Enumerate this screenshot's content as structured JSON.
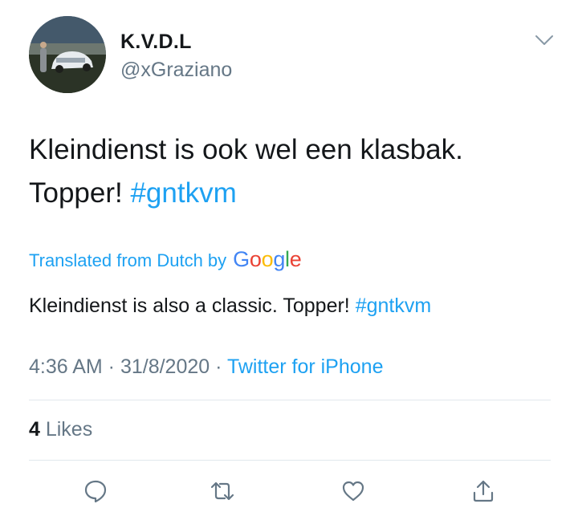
{
  "user": {
    "display_name": "K.V.D.L",
    "handle": "@xGraziano"
  },
  "tweet": {
    "text_line1": "Kleindienst is ook wel een klasbak.",
    "text_line2_prefix": "Topper! ",
    "hashtag": "#gntkvm"
  },
  "translation": {
    "label": "Translated from Dutch by",
    "provider": "Google",
    "text_prefix": "Kleindienst is also a classic. Topper! ",
    "hashtag": "#gntkvm"
  },
  "meta": {
    "time": "4:36 AM",
    "separator": " · ",
    "date": "31/8/2020",
    "source": "Twitter for iPhone"
  },
  "likes": {
    "count": "4",
    "label": " Likes"
  },
  "actions": {
    "reply_icon": "comment-icon",
    "retweet_icon": "retweet-icon",
    "like_icon": "heart-icon",
    "share_icon": "share-icon"
  },
  "colors": {
    "link": "#1da1f2",
    "secondary": "#657786",
    "text": "#14171a",
    "divider": "#e1e8ed"
  }
}
